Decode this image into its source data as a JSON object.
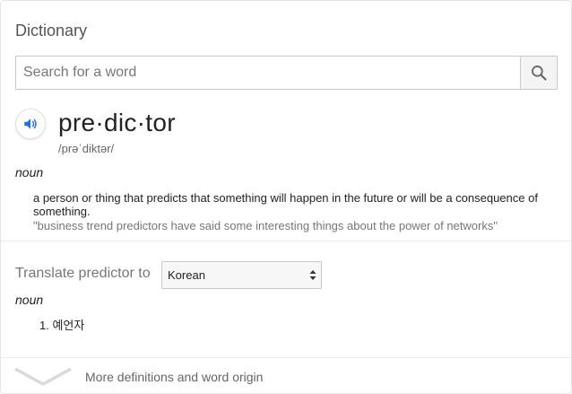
{
  "dictionary": {
    "title": "Dictionary",
    "search": {
      "placeholder": "Search for a word",
      "value": "",
      "button_icon": "search-icon"
    },
    "entry": {
      "audio_icon": "speaker-icon",
      "headword": "pre·dic·tor",
      "phonetic": "/prəˈdiktər/",
      "part_of_speech": "noun",
      "definition": "a person or thing that predicts that something will happen in the future or will be a consequence of something.",
      "example": "\"business trend predictors have said some interesting things about the power of networks\""
    },
    "translate": {
      "label": "Translate predictor to",
      "selected_language": "Korean",
      "part_of_speech": "noun",
      "items": [
        {
          "number": "1.",
          "text": "예언자"
        }
      ]
    },
    "more": {
      "icon": "chevron-down-icon",
      "label": "More definitions and word origin"
    },
    "colors": {
      "accent": "#1a73e8",
      "muted_text": "#777777",
      "border": "#c8c8c8"
    }
  }
}
